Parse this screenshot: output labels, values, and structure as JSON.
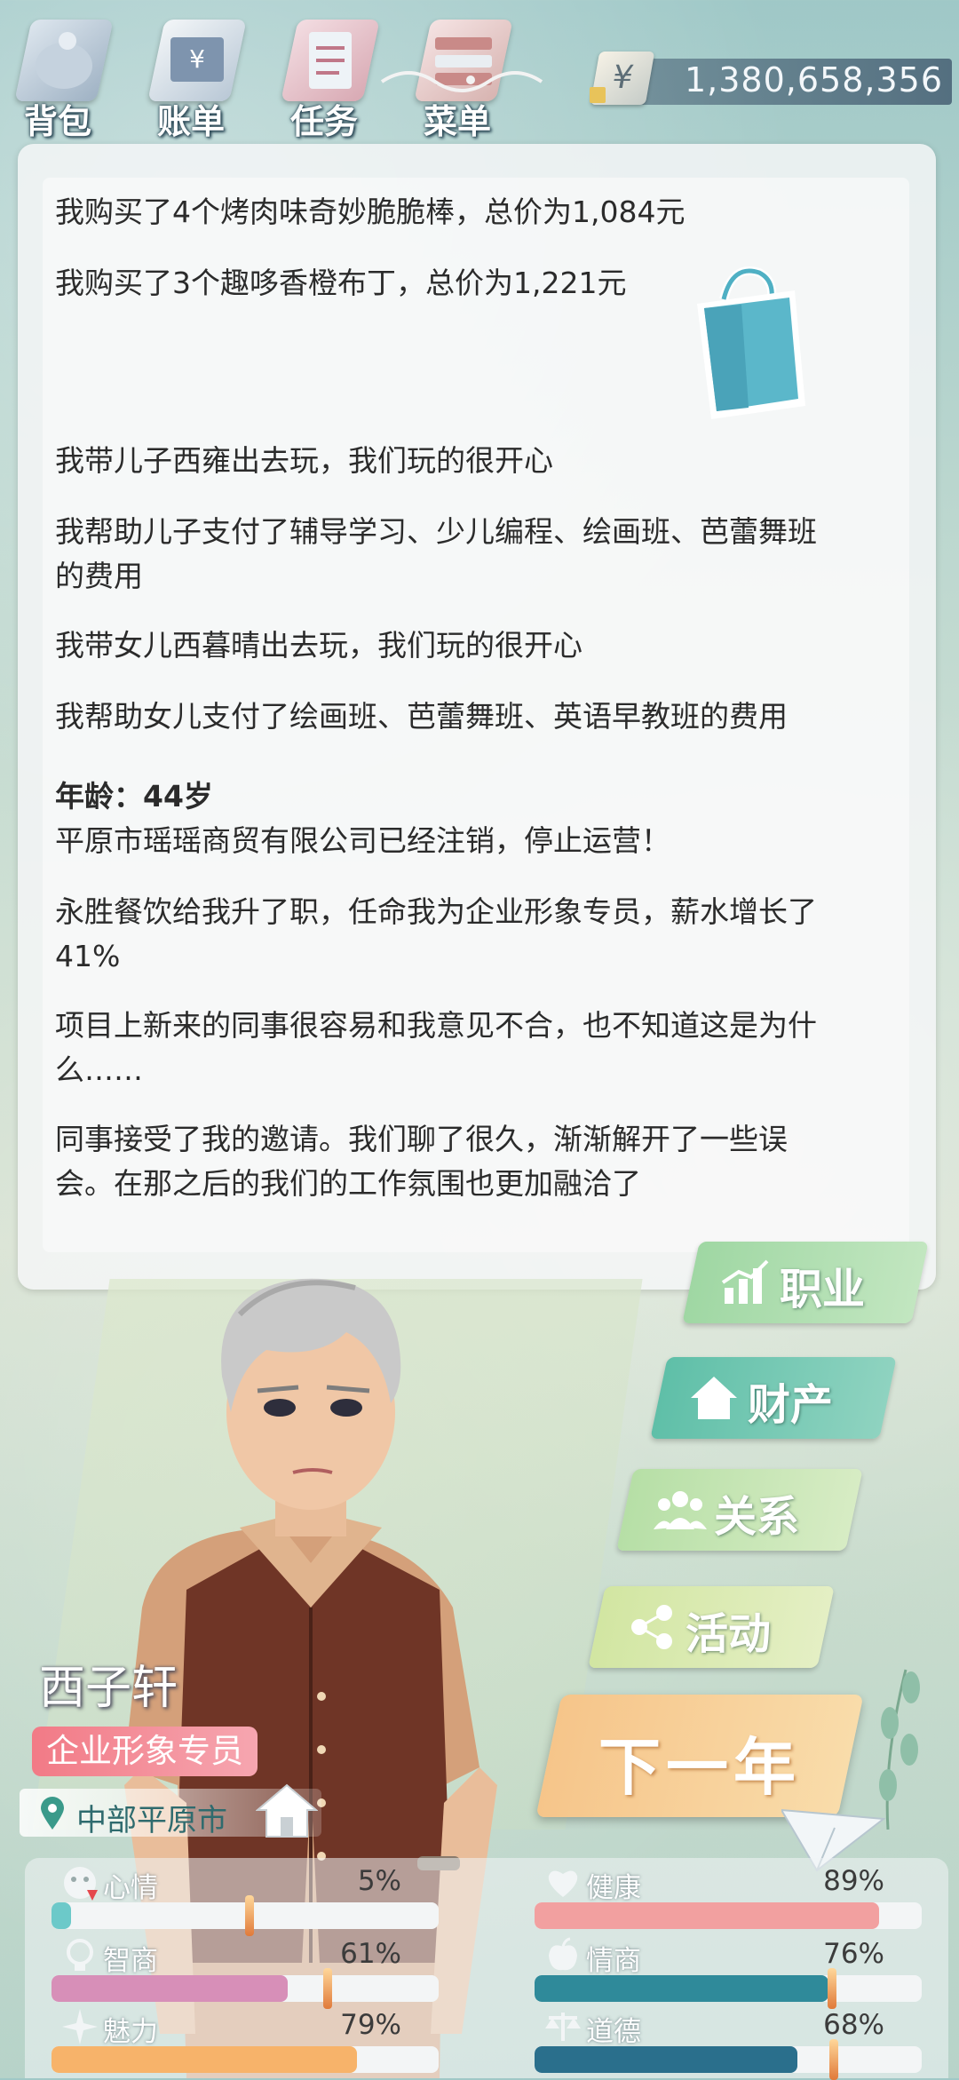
{
  "nav": {
    "items": [
      {
        "label": "背包",
        "icon": "backpack-icon"
      },
      {
        "label": "账单",
        "icon": "bill-icon"
      },
      {
        "label": "任务",
        "icon": "task-icon"
      },
      {
        "label": "菜单",
        "icon": "menu-icon"
      }
    ],
    "money": "1,380,658,356",
    "money_symbol": "¥"
  },
  "log": {
    "lines": [
      "我购买了4个烤肉味奇妙脆脆棒，总价为1,084元",
      "我购买了3个趣哆香橙布丁，总价为1,221元",
      "我带儿子西雍出去玩，我们玩的很开心",
      "我帮助儿子支付了辅导学习、少儿编程、绘画班、芭蕾舞班",
      "的费用",
      "我带女儿西暮晴出去玩，我们玩的很开心",
      "我帮助女儿支付了绘画班、芭蕾舞班、英语早教班的费用",
      "年龄：44岁",
      "平原市瑶瑶商贸有限公司已经注销，停止运营！",
      "永胜餐饮给我升了职，任命我为企业形象专员，薪水增长了",
      "41%",
      "项目上新来的同事很容易和我意见不合，也不知道这是为什",
      "么……",
      "同事接受了我的邀请。我们聊了很久，渐渐解开了一些误",
      "会。在那之后的我们的工作氛围也更加融洽了"
    ]
  },
  "actions": {
    "career": "职业",
    "property": "财产",
    "relations": "关系",
    "activity": "活动",
    "next_year": "下一年"
  },
  "character": {
    "name": "西子轩",
    "job": "企业形象专员",
    "location": "中部平原市"
  },
  "stats": {
    "mood": {
      "label": "心情",
      "value": "5%",
      "fraction": 0.05,
      "color": "#6cc9c9"
    },
    "health": {
      "label": "健康",
      "value": "89%",
      "fraction": 0.89,
      "color": "#f2a0a0"
    },
    "iq": {
      "label": "智商",
      "value": "61%",
      "fraction": 0.61,
      "color": "#d78fb8"
    },
    "eq": {
      "label": "情商",
      "value": "76%",
      "fraction": 0.76,
      "color": "#2f8a9a"
    },
    "charm": {
      "label": "魅力",
      "value": "79%",
      "fraction": 0.79,
      "color": "#f7b36a"
    },
    "morality": {
      "label": "道德",
      "value": "68%",
      "fraction": 0.68,
      "color": "#2a6f8c"
    }
  }
}
